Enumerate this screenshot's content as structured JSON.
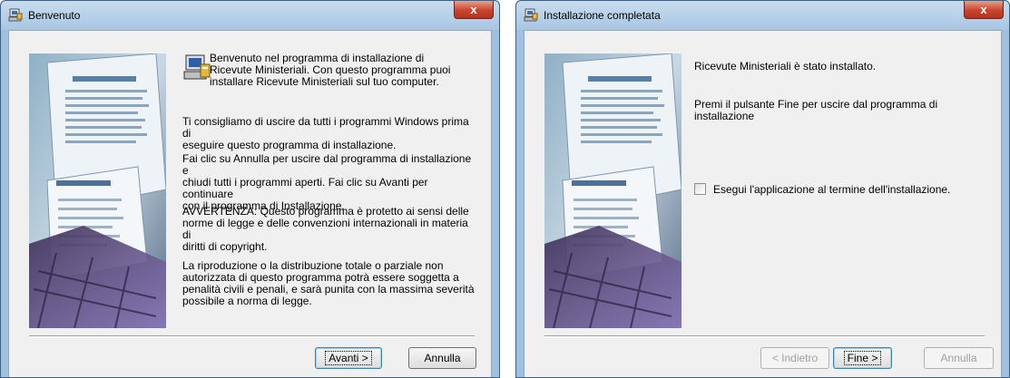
{
  "welcome": {
    "title": "Benvenuto",
    "close_glyph": "x",
    "intro": "Benvenuto nel programma di installazione di\nRicevute Ministeriali. Con questo programma puoi\ninstallare Ricevute Ministeriali sul tuo computer.",
    "paragraph1": "Ti consigliamo di uscire da tutti i programmi Windows prima di\neseguire questo programma di installazione.",
    "paragraph2": "Fai clic su Annulla per uscire dal programma di installazione e\nchiudi tutti i programmi aperti. Fai clic su Avanti per continuare\ncon il programma di Installazione.",
    "paragraph3": "AVVERTENZA: Questo programma è protetto ai sensi delle\nnorme di legge e delle convenzioni internazionali in materia di\ndiritti di copyright.",
    "paragraph4": "La riproduzione o la distribuzione totale o parziale non\nautorizzata di questo programma potrà essere soggetta a\npenalità civili e penali, e sarà punita con la massima severità\npossibile a norma di legge.",
    "next_label": "Avanti >",
    "cancel_label": "Annulla"
  },
  "complete": {
    "title": "Installazione completata",
    "close_glyph": "x",
    "line1": "Ricevute Ministeriali è stato installato.",
    "line2": "Premi il pulsante Fine per uscire dal programma di installazione",
    "checkbox_label": "Esegui l'applicazione al termine dell'installazione.",
    "checkbox_checked": false,
    "back_label": "< Indietro",
    "finish_label": "Fine >",
    "cancel_label": "Annulla"
  },
  "icons": [
    "setup-app-icon",
    "close-icon",
    "installer-computer-icon"
  ],
  "colors": {
    "frame": "#9fc0df",
    "close": "#c7442f",
    "client": "#f0f0f0"
  }
}
